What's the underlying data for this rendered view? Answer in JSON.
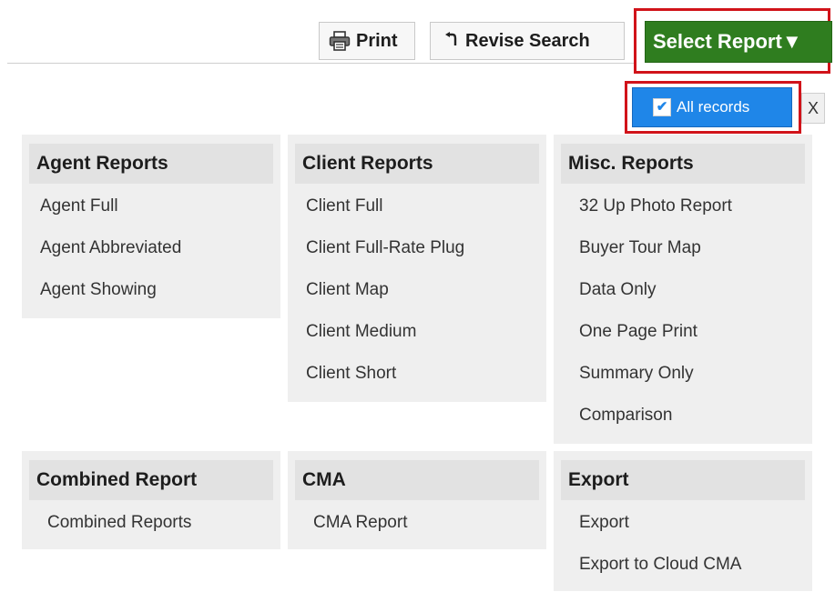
{
  "toolbar": {
    "print_label": "Print",
    "revise_label": "Revise Search",
    "select_report_label": "Select Report▼",
    "all_records_label": "All records",
    "close_label": "X"
  },
  "icons": {
    "print": "printer-icon",
    "revise": "undo-arrow-icon",
    "all_records": "checkbox-checked-icon"
  },
  "colors": {
    "select_report_bg": "#2f7d1f",
    "all_records_bg": "#1f86e8",
    "highlight_border": "#d1131a",
    "panel_bg": "#efefef",
    "panel_header_bg": "#e2e2e2"
  },
  "report_groups": [
    {
      "title": "Agent Reports",
      "items": [
        "Agent Full",
        "Agent Abbreviated",
        "Agent Showing"
      ]
    },
    {
      "title": "Client Reports",
      "items": [
        "Client Full",
        "Client Full-Rate Plug",
        "Client Map",
        "Client Medium",
        "Client Short"
      ]
    },
    {
      "title": "Misc. Reports",
      "items": [
        "32 Up Photo Report",
        "Buyer Tour Map",
        "Data Only",
        "One Page Print",
        "Summary Only",
        "Comparison"
      ]
    },
    {
      "title": "Combined Report",
      "items": [
        "Combined Reports"
      ]
    },
    {
      "title": "CMA",
      "items": [
        "CMA Report"
      ]
    },
    {
      "title": "Export",
      "items": [
        "Export",
        "Export to Cloud CMA"
      ]
    }
  ]
}
